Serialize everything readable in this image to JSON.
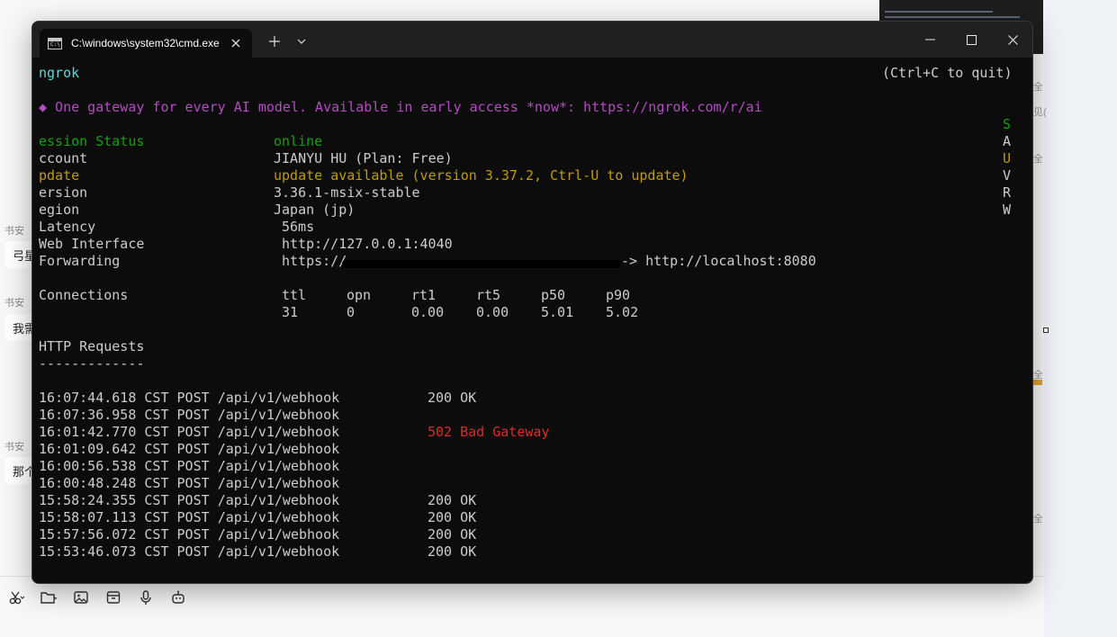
{
  "background_app": {
    "messages": [
      {
        "name": "书安",
        "text": "弓星"
      },
      {
        "name": "书安",
        "text": "我需"
      },
      {
        "name": "书安",
        "text": "那个"
      }
    ],
    "side_fragments": [
      "全",
      "见(",
      "全",
      "全",
      "全"
    ],
    "toolbar_icons": [
      "scissors-icon",
      "folder-icon",
      "image-icon",
      "box-icon",
      "microphone-icon",
      "robot-icon"
    ]
  },
  "terminal_window": {
    "tab_title": "C:\\windows\\system32\\cmd.exe",
    "tab_icon_text": "C:\\",
    "new_tab_label": "+",
    "dropdown_label": "⌄"
  },
  "ngrok": {
    "app_name": "ngrok",
    "quit_hint": "(Ctrl+C to quit)",
    "announcement": "◆ One gateway for every AI model. Available in early access *now*: https://ngrok.com/r/ai",
    "right_letters": [
      "S",
      "A",
      "U",
      "V",
      "R",
      "W"
    ],
    "status_rows": [
      {
        "label": "ession Status",
        "value": "online"
      },
      {
        "label": "ccount",
        "value": "JIANYU HU (Plan: Free)"
      },
      {
        "label": "pdate",
        "value": "update available (version 3.37.2, Ctrl-U to update)"
      },
      {
        "label": "ersion",
        "value": "3.36.1-msix-stable"
      },
      {
        "label": "egion",
        "value": "Japan (jp)"
      },
      {
        "label": "Latency",
        "value": "56ms"
      },
      {
        "label": "Web Interface",
        "value": "http://127.0.0.1:4040"
      },
      {
        "label": "Forwarding",
        "value": "https://",
        "value_suffix": "-> http://localhost:8080"
      }
    ],
    "connections": {
      "label": "Connections",
      "headers": [
        "ttl",
        "opn",
        "rt1",
        "rt5",
        "p50",
        "p90"
      ],
      "values": [
        "31",
        "0",
        "0.00",
        "0.00",
        "5.01",
        "5.02"
      ]
    },
    "http_requests": {
      "title": "HTTP Requests",
      "underline": "-------------",
      "rows": [
        {
          "time": "16:07:44.618 CST",
          "method": "POST",
          "path": "/api/v1/webhook",
          "status": "200 OK"
        },
        {
          "time": "16:07:36.958 CST",
          "method": "POST",
          "path": "/api/v1/webhook",
          "status": ""
        },
        {
          "time": "16:01:42.770 CST",
          "method": "POST",
          "path": "/api/v1/webhook",
          "status": "502 Bad Gateway"
        },
        {
          "time": "16:01:09.642 CST",
          "method": "POST",
          "path": "/api/v1/webhook",
          "status": ""
        },
        {
          "time": "16:00:56.538 CST",
          "method": "POST",
          "path": "/api/v1/webhook",
          "status": ""
        },
        {
          "time": "16:00:48.248 CST",
          "method": "POST",
          "path": "/api/v1/webhook",
          "status": ""
        },
        {
          "time": "15:58:24.355 CST",
          "method": "POST",
          "path": "/api/v1/webhook",
          "status": "200 OK"
        },
        {
          "time": "15:58:07.113 CST",
          "method": "POST",
          "path": "/api/v1/webhook",
          "status": "200 OK"
        },
        {
          "time": "15:57:56.072 CST",
          "method": "POST",
          "path": "/api/v1/webhook",
          "status": "200 OK"
        },
        {
          "time": "15:53:46.073 CST",
          "method": "POST",
          "path": "/api/v1/webhook",
          "status": "200 OK"
        }
      ]
    }
  }
}
